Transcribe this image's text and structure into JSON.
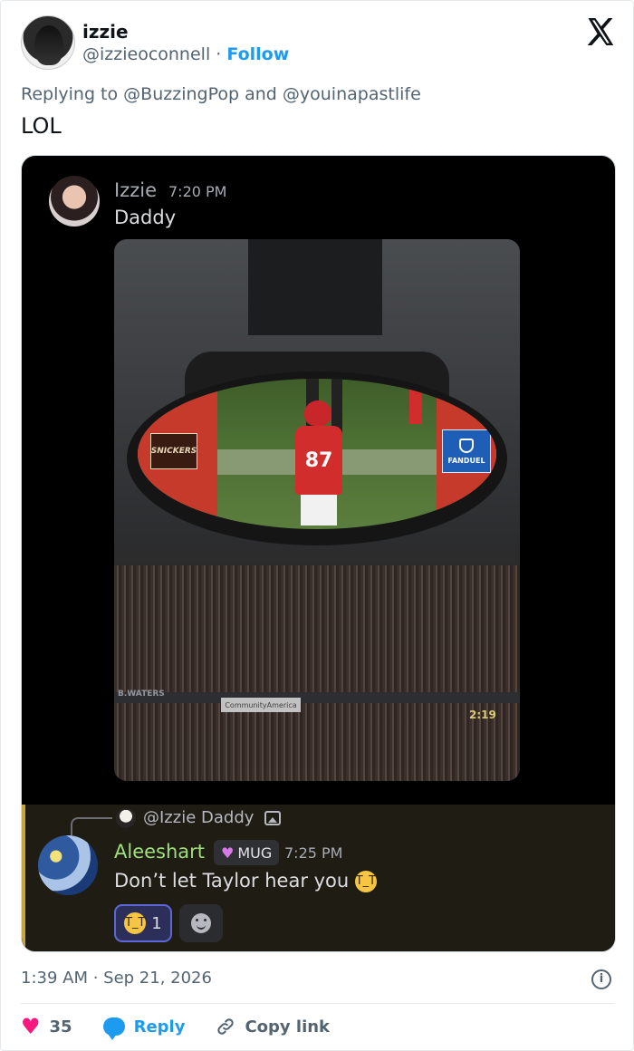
{
  "post": {
    "display_name": "izzie",
    "handle": "@izzieoconnell",
    "separator": "·",
    "follow_label": "Follow",
    "replying_prefix": "Replying to",
    "mention_1": "@BuzzingPop",
    "mention_and": "and",
    "mention_2": "@youinapastlife",
    "text": "LOL",
    "timestamp": "1:39 AM · Sep 21, 2026"
  },
  "embedded": {
    "message": {
      "author": "Izzie",
      "time": "7:20 PM",
      "text": "Daddy"
    },
    "photo": {
      "ad_left": "SNICKERS",
      "ad_right": "FANDUEL",
      "jersey_number": "87",
      "banner_left": "B.WATERS",
      "banner_center": "CommunityAmerica",
      "clock": "2:19"
    },
    "reply": {
      "ref_author": "@Izzie",
      "ref_text": "Daddy",
      "author": "Aleeshart",
      "badge": "MUG",
      "time": "7:25 PM",
      "text": "Don’t let Taylor hear you",
      "reaction_count": "1"
    }
  },
  "actions": {
    "likes": "35",
    "reply_label": "Reply",
    "copy_label": "Copy link"
  },
  "colors": {
    "like": "#f91880",
    "link": "#1d9bf0",
    "muted": "#536471",
    "discord_username": "#9fe07a"
  },
  "icons": {
    "close": "x-logo-icon",
    "like": "heart-icon",
    "reply": "speech-bubble-icon",
    "copy": "link-icon",
    "info": "info-icon"
  }
}
